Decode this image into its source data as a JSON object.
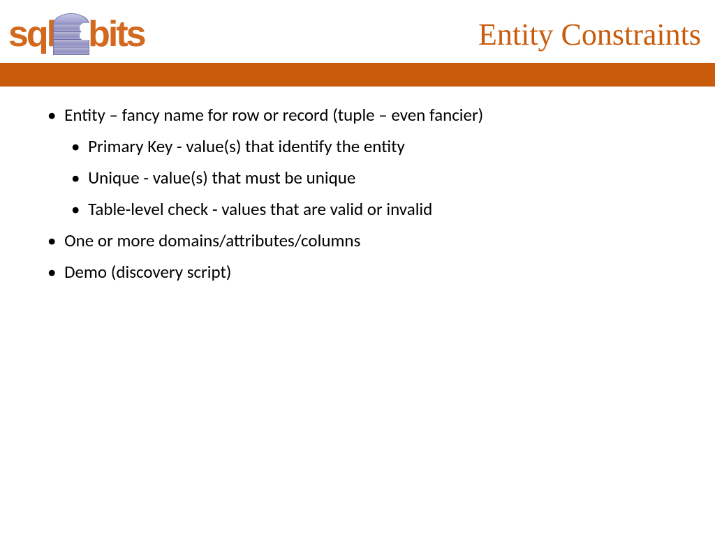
{
  "logo": {
    "left": "sql",
    "right": "bits"
  },
  "title": "Entity Constraints",
  "bullets": {
    "b1": "Entity – fancy name for row or record (tuple – even fancier)",
    "b1a": "Primary Key - value(s) that identify the entity",
    "b1b": "Unique - value(s) that must be unique",
    "b1c": "Table-level check - values that are valid or invalid",
    "b2": "One or more domains/attributes/columns",
    "b3": "Demo (discovery script)"
  }
}
